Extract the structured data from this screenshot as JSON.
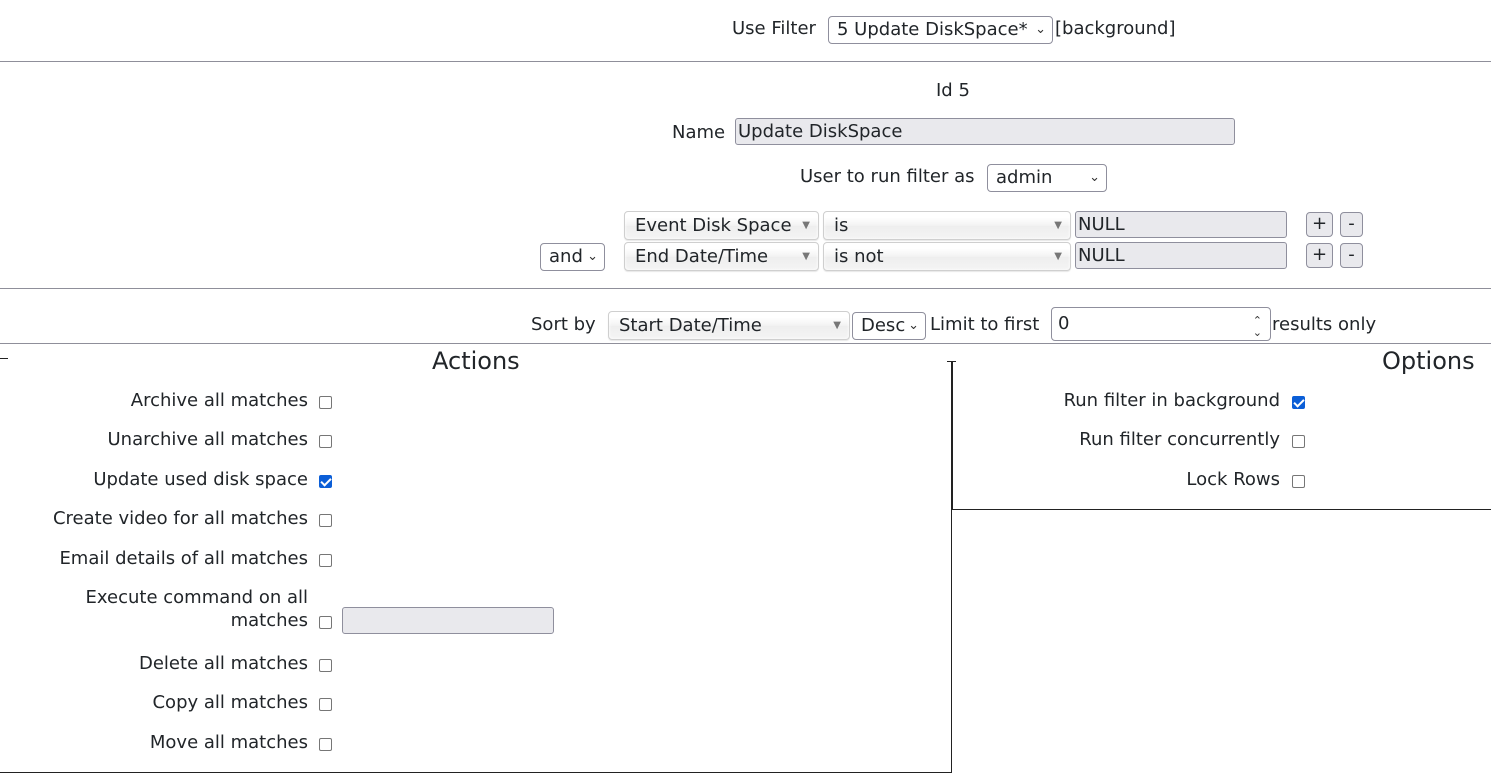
{
  "top": {
    "use_filter_label": "Use Filter",
    "filter_select_value": "5 Update DiskSpace*",
    "background_tag": "[background]"
  },
  "filter": {
    "id_text": "Id 5",
    "name_label": "Name",
    "name_value": "Update DiskSpace",
    "run_as_label": "User to run filter as",
    "run_as_value": "admin",
    "terms": [
      {
        "field": "Event Disk Space",
        "operator": "is",
        "value": "NULL"
      },
      {
        "conjunction": "and",
        "field": "End Date/Time",
        "operator": "is not",
        "value": "NULL"
      }
    ],
    "plus_label": "+",
    "minus_label": "-"
  },
  "sort": {
    "sort_by_label": "Sort by",
    "sort_field": "Start Date/Time",
    "sort_dir": "Desc",
    "limit_label": "Limit to first",
    "limit_value": "0",
    "results_only_label": "results only"
  },
  "actions": {
    "heading": "Actions",
    "items": [
      {
        "label": "Archive all matches",
        "checked": false
      },
      {
        "label": "Unarchive all matches",
        "checked": false
      },
      {
        "label": "Update used disk space",
        "checked": true
      },
      {
        "label": "Create video for all matches",
        "checked": false
      },
      {
        "label": "Email details of all matches",
        "checked": false
      },
      {
        "label_line1": "Execute command on all",
        "label_line2": "matches",
        "checked": false,
        "command_value": ""
      },
      {
        "label": "Delete all matches",
        "checked": false
      },
      {
        "label": "Copy all matches",
        "checked": false
      },
      {
        "label": "Move all matches",
        "checked": false
      }
    ]
  },
  "options": {
    "heading": "Options",
    "items": [
      {
        "label": "Run filter in background",
        "checked": true
      },
      {
        "label": "Run filter concurrently",
        "checked": false
      },
      {
        "label": "Lock Rows",
        "checked": false
      }
    ]
  },
  "colors": {
    "checkbox_checked": "#0b5ed7",
    "rule": "#8f8f9a"
  },
  "icons": {
    "dropdown": "chevron-down-icon",
    "chosen": "triangle-down-icon",
    "spinner": "spinner-icon"
  }
}
